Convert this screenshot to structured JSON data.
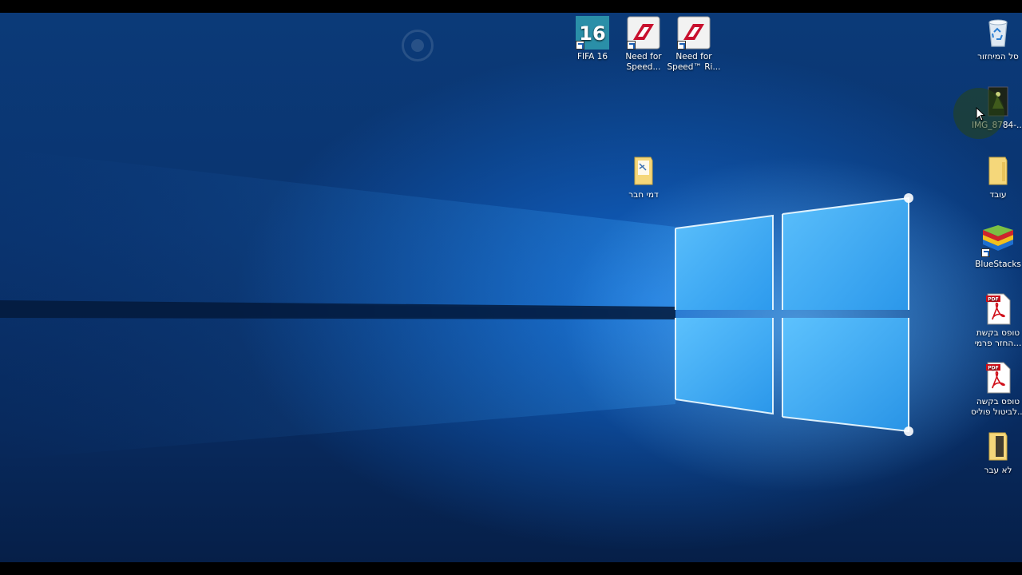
{
  "desktop": {
    "icons": [
      {
        "label": "FIFA 16",
        "icon": "fifa16-game-icon"
      },
      {
        "label": "Need for Speed...",
        "icon": "need-for-speed-icon"
      },
      {
        "label": "Need for Speed™ Ri...",
        "icon": "need-for-speed-rivals-icon"
      },
      {
        "label": "סל המיחזור",
        "icon": "recycle-bin-icon"
      },
      {
        "label": "IMG_8784-...",
        "icon": "image-file-icon"
      },
      {
        "label": "דמי חבר",
        "icon": "folder-icon"
      },
      {
        "label": "עובד",
        "icon": "folder-icon"
      },
      {
        "label": "BlueStacks",
        "icon": "bluestacks-icon"
      },
      {
        "label": "טופס בקשת החזר פרמי...",
        "icon": "pdf-file-icon"
      },
      {
        "label": "טופס בקשה לביטול פוליס...",
        "icon": "pdf-file-icon"
      },
      {
        "label": "לא עבר",
        "icon": "folder-icon"
      }
    ]
  },
  "colors": {
    "wallpaper_dark": "#061f48",
    "wallpaper_mid": "#0a3470",
    "glow": "#78c8ff"
  }
}
